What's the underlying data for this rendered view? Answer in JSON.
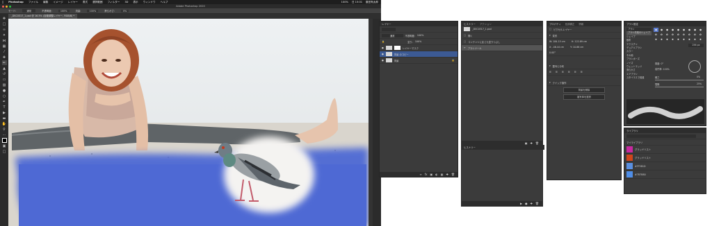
{
  "mac_menu": {
    "apple": "",
    "items": [
      "Photoshop",
      "ファイル",
      "編集",
      "イメージ",
      "レイヤー",
      "書式",
      "選択範囲",
      "フィルター",
      "3D",
      "表示",
      "ウィンドウ",
      "ヘルプ"
    ],
    "status": [
      "100%",
      "日 15:01",
      "藤田有太郎"
    ]
  },
  "window": {
    "title": "Adobe Photoshop 2020",
    "options_bar": [
      "モード:",
      "通常",
      "不透明度:",
      "100%",
      "流量:",
      "100%",
      "滑らかさ:",
      "0%"
    ],
    "tab": "_DSC0317_1.psd @ 16.5% (自動調整レイヤー, RGB/8) *"
  },
  "layers_panel": {
    "tabs": [
      "レイヤー"
    ],
    "mode": "通常",
    "opacity_label": "不透明度:",
    "opacity": "100%",
    "fill_label": "塗り:",
    "fill": "100%",
    "layers": [
      {
        "name": "レイヤーマスク"
      },
      {
        "name": "背景 のコピー"
      },
      {
        "name": "背景"
      }
    ]
  },
  "history_panel": {
    "tabs": [
      "ヒストリー",
      "アクション"
    ],
    "snapshot": "_DSC0317_1.psd",
    "items": [
      "開く",
      "コンテンツに応じた塗りつぶし",
      "ブラシツール"
    ],
    "bottom_title": "ヒストリー"
  },
  "properties_panel": {
    "tabs": [
      "プロパティ",
      "色調補正",
      "情報"
    ],
    "title": "ピクセルレイヤー",
    "section_transform": "変形",
    "w": "W: 184.15 cm",
    "h": "H: 122.89 cm",
    "x": "X: -46.44 cm",
    "y": "Y: 10.86 cm",
    "angle": "0.00°",
    "section_align": "整列と分布",
    "section_quick": "クイック操作",
    "btn1": "背景を削除",
    "btn2": "被写体を選択"
  },
  "brush_panel": {
    "tabs": [
      "ブラシ設定"
    ],
    "brush_label": "ブラシ",
    "options": [
      "ブラシ先端のシェイプ",
      "シェイプ",
      "散布",
      "テクスチャ",
      "デュアルブラシ",
      "カラー",
      "その他",
      "ブラシポーズ",
      "ノイズ",
      "ウェットエッジ",
      "滑らかさ",
      "エアブラシ",
      "スタイラスで保護"
    ],
    "size": "256 px",
    "angle": "角度: 0°",
    "roundness": "真円率: 100%",
    "hardness": "硬さ",
    "hardness_value": "0%",
    "spacing": "間隔",
    "spacing_value": "25%"
  },
  "library_panel": {
    "tabs": [
      "ライブラリ"
    ],
    "lib_name": "マイライブラリ",
    "items": [
      "グラッドリスト",
      "グラッドリスト",
      "#FF5B1D",
      "#7B7B80"
    ]
  },
  "colors": {
    "layer_selected": "#3c5a94",
    "mask_blue": "#4e69d4",
    "swatch_magenta": "#c828a0",
    "swatch_red": "#d0451b",
    "swatch_blue1": "#5a8fe0",
    "swatch_blue2": "#4f8ee8"
  }
}
